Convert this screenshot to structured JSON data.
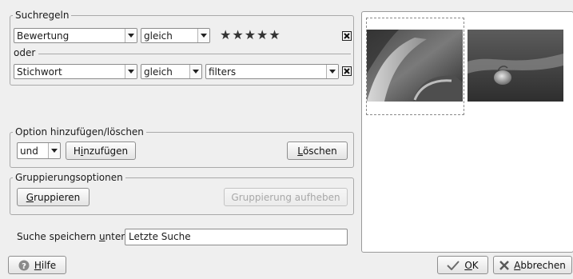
{
  "rules": {
    "title": "Suchregeln",
    "row1": {
      "field": "Bewertung",
      "operator": "gleich",
      "stars": "★★★★★"
    },
    "separator": "oder",
    "row2": {
      "field": "Stichwort",
      "operator": "gleich",
      "value": "filters"
    }
  },
  "options": {
    "title": "Option hinzufügen/löschen",
    "conjunction": "und",
    "add_prefix": "H",
    "add_mnemonic": "i",
    "add_suffix": "nzufügen",
    "delete_mnemonic": "L",
    "delete_suffix": "öschen"
  },
  "grouping": {
    "title": "Gruppierungsoptionen",
    "group_mnemonic": "G",
    "group_suffix": "ruppieren",
    "ungroup_label": "Gruppierung aufheben"
  },
  "save": {
    "label_prefix": "Suche speichern ",
    "label_mnemonic": "u",
    "label_suffix": "nter:",
    "name": "Letzte Suche"
  },
  "footer": {
    "help_mnemonic": "H",
    "help_suffix": "ilfe",
    "ok_mnemonic": "O",
    "ok_suffix": "K",
    "cancel_mnemonic": "A",
    "cancel_suffix": "bbrechen"
  },
  "colors": {
    "background": "#efefef",
    "border": "#a9a9a9",
    "disabled_text": "#a8a8a8",
    "ok_check": "#6b6b6b"
  }
}
